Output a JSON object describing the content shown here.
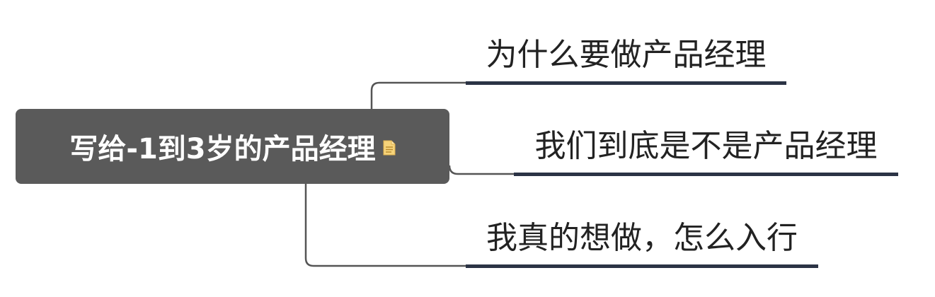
{
  "root": {
    "title": "写给-1到3岁的产品经理",
    "note_icon": "note-icon"
  },
  "branches": [
    {
      "label": "为什么要做产品经理"
    },
    {
      "label": "我们到底是不是产品经理"
    },
    {
      "label": "我真的想做，怎么入行"
    }
  ],
  "colors": {
    "root_fill": "#5a5a5a",
    "root_text": "#ffffff",
    "branch_underline": "#2b3345",
    "connector": "#555555",
    "note_icon": "#f6d37a"
  }
}
